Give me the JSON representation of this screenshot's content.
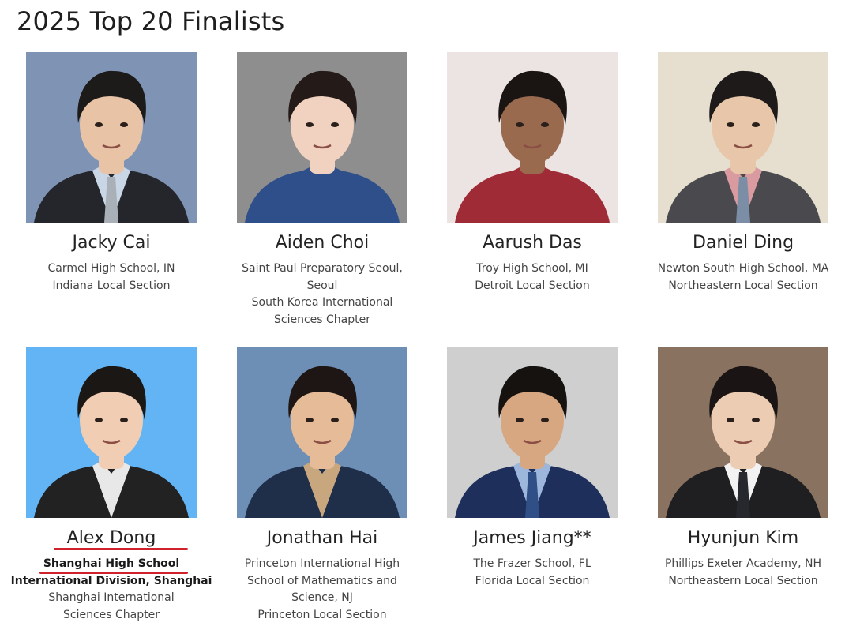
{
  "page": {
    "title": "2025 Top 20 Finalists"
  },
  "finalists": [
    {
      "name": "Jacky Cai",
      "lines": [
        "Carmel High School, IN",
        "Indiana Local Section"
      ],
      "bg": "#7f94b5",
      "skin": "#e8c3a6",
      "hair": "#1d1a1a",
      "shirt": "#24262c",
      "collar": "#c9d6e6",
      "tie": "#aab0b8"
    },
    {
      "name": "Aiden Choi",
      "lines": [
        "Saint Paul Preparatory Seoul,",
        "Seoul",
        "South Korea International",
        "Sciences Chapter"
      ],
      "bg": "#8e8e8e",
      "skin": "#f1d2c0",
      "hair": "#241b19",
      "shirt": "#2e4f8a",
      "collar": "#2e4f8a",
      "tie": ""
    },
    {
      "name": "Aarush Das",
      "lines": [
        "Troy High School, MI",
        "Detroit Local Section"
      ],
      "bg": "#ece4e2",
      "skin": "#9a6a4f",
      "hair": "#1a1513",
      "shirt": "#9e2b35",
      "collar": "#9e2b35",
      "tie": ""
    },
    {
      "name": "Daniel Ding",
      "lines": [
        "Newton South High School, MA",
        "Northeastern Local Section"
      ],
      "bg": "#e6dfd0",
      "skin": "#e7c6a9",
      "hair": "#1e1a19",
      "shirt": "#4a4a4e",
      "collar": "#d99aa0",
      "tie": "#7c8ea6"
    },
    {
      "name": "Alex Dong",
      "lines": [
        "Shanghai High School",
        "International Division, Shanghai",
        "Shanghai International",
        "Sciences Chapter"
      ],
      "bg": "#63b4f4",
      "skin": "#f0cdb3",
      "hair": "#1b1715",
      "shirt": "#222222",
      "collar": "#e8e8e8",
      "tie": ""
    },
    {
      "name": "Jonathan Hai",
      "lines": [
        "Princeton International High",
        "School of Mathematics and",
        "Science, NJ",
        "Princeton Local Section"
      ],
      "bg": "#6e8fb5",
      "skin": "#e6bc98",
      "hair": "#1d1614",
      "shirt": "#1f2f4a",
      "collar": "#c8a77e",
      "tie": ""
    },
    {
      "name": "James Jiang**",
      "lines": [
        "The Frazer School, FL",
        "Florida Local Section"
      ],
      "bg": "#cfcfcf",
      "skin": "#d7a782",
      "hair": "#15120f",
      "shirt": "#1e2f5c",
      "collar": "#9db6dc",
      "tie": "#2f4f86"
    },
    {
      "name": "Hyunjun Kim",
      "lines": [
        "Phillips Exeter Academy, NH",
        "Northeastern Local Section"
      ],
      "bg": "#8a7260",
      "skin": "#eccdb4",
      "hair": "#1a1514",
      "shirt": "#1f1f22",
      "collar": "#f2f2f2",
      "tie": "#26282e"
    }
  ]
}
